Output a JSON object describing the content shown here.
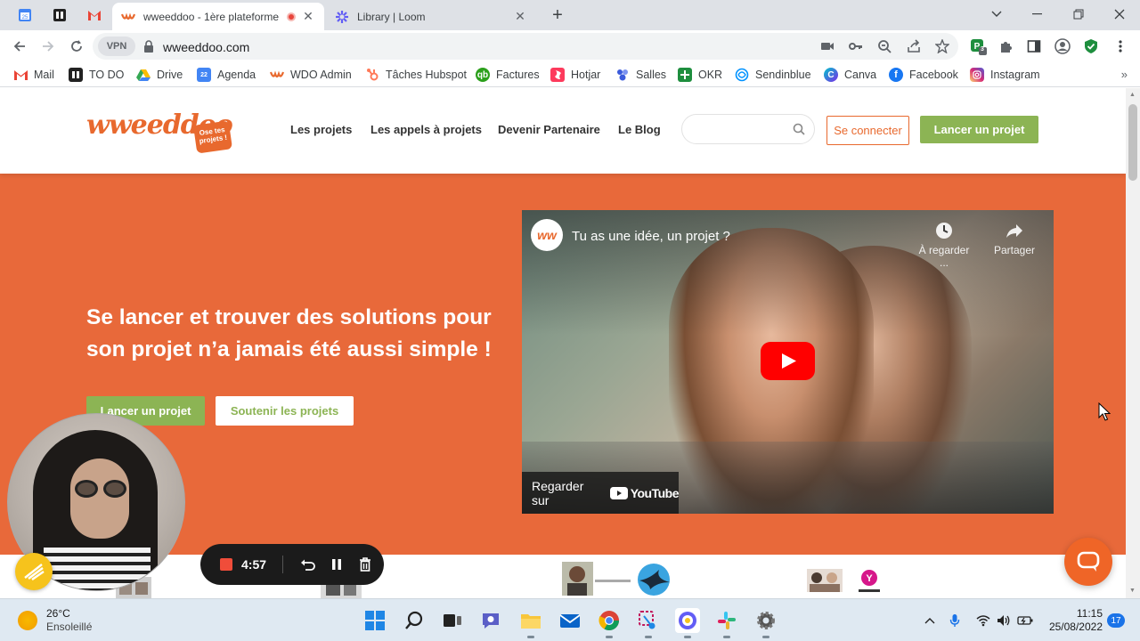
{
  "browser": {
    "tabs": [
      {
        "title": "wweeddoo - 1ère plateforme"
      },
      {
        "title": "Library | Loom"
      }
    ],
    "url": "wweeddoo.com",
    "vpn_label": "VPN",
    "extension_badge": "3"
  },
  "bookmarks": [
    {
      "label": "Mail",
      "color": "#ea4335"
    },
    {
      "label": "TO DO",
      "color": "#222222"
    },
    {
      "label": "Drive",
      "color": "#34a853"
    },
    {
      "label": "Agenda",
      "color": "#4285f4"
    },
    {
      "label": "WDO Admin",
      "color": "#e8692e"
    },
    {
      "label": "Tâches Hubspot",
      "color": "#ff7a59"
    },
    {
      "label": "Factures",
      "color": "#2ca01c"
    },
    {
      "label": "Hotjar",
      "color": "#fd3a5c"
    },
    {
      "label": "Salles",
      "color": "#3b5bdb"
    },
    {
      "label": "OKR",
      "color": "#1e8e3e"
    },
    {
      "label": "Sendinblue",
      "color": "#0092ff"
    },
    {
      "label": "Canva",
      "color": "#00c4cc"
    },
    {
      "label": "Facebook",
      "color": "#1877f2"
    },
    {
      "label": "Instagram",
      "color": "#d62976"
    }
  ],
  "site": {
    "logo_text": "wweeddoo",
    "logo_tag": "Ose tes projets !",
    "nav": [
      "Les projets",
      "Les appels à projets",
      "Devenir Partenaire",
      "Le Blog"
    ],
    "search_placeholder": "",
    "connect_label": "Se connecter",
    "launch_label": "Lancer un projet",
    "hero_title": "Se lancer et trouver des solutions pour son projet n’a jamais été aussi simple !",
    "hero_launch_label": "Lancer un projet",
    "hero_support_label": "Soutenir les projets",
    "accent_color": "#e8693a",
    "green_color": "#8cb454"
  },
  "video": {
    "channel_initials": "ww",
    "title": "Tu as une idée, un projet ?",
    "watch_later": "À regarder ...",
    "share": "Partager",
    "watch_on": "Regarder sur",
    "youtube": "YouTube"
  },
  "loom": {
    "timer": "4:57"
  },
  "taskbar": {
    "temperature": "26°C",
    "weather": "Ensoleillé",
    "time": "11:15",
    "date": "25/08/2022",
    "notifications": "17"
  }
}
